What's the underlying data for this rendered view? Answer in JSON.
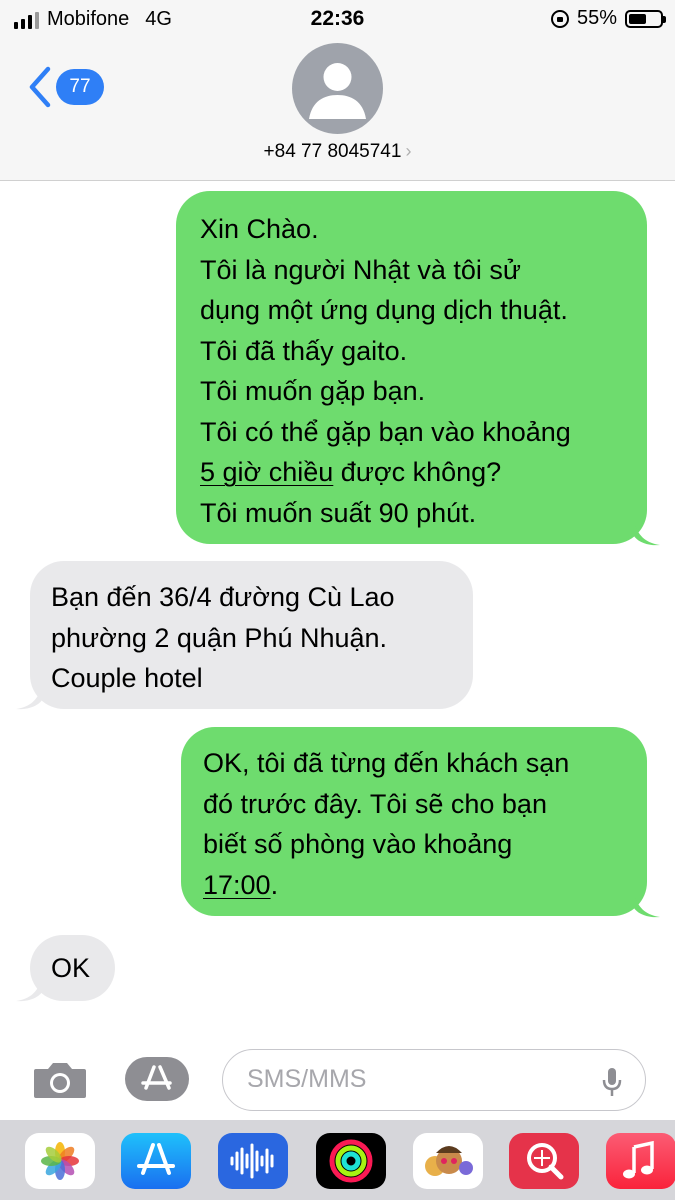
{
  "status_bar": {
    "carrier": "Mobifone",
    "network": "4G",
    "time": "22:36",
    "battery_percent": "55%",
    "battery_level": 0.55
  },
  "header": {
    "back_count": "77",
    "contact_number": "+84 77 8045741",
    "contact_arrow": "›"
  },
  "messages": [
    {
      "direction": "sent",
      "lines": [
        "Xin Chào.",
        "Tôi là người Nhật và tôi sử",
        "dụng một ứng dụng dịch thuật.",
        "Tôi đã thấy gaito.",
        "Tôi muốn gặp bạn.",
        "Tôi có thể gặp bạn vào khoảng",
        "5 giờ chiều",
        " được không?",
        "Tôi muốn suất 90 phút."
      ]
    },
    {
      "direction": "received",
      "lines": [
        "Bạn đến 36/4 đường Cù Lao",
        "phường 2 quận Phú Nhuận.",
        "Couple hotel"
      ]
    },
    {
      "direction": "sent",
      "lines": [
        "OK, tôi đã từng đến khách sạn",
        "đó trước đây.  Tôi sẽ cho bạn",
        "biết số phòng vào khoảng",
        "17:00",
        "."
      ]
    },
    {
      "direction": "received",
      "lines": [
        "OK"
      ]
    }
  ],
  "input": {
    "placeholder": "SMS/MMS"
  },
  "colors": {
    "sent_bubble": "#6edc6e",
    "received_bubble": "#e9e9eb",
    "accent": "#2f7ff6"
  },
  "icons": [
    "camera-icon",
    "app-store-icon",
    "microphone-icon",
    "photos-app-icon",
    "app-store-app-icon",
    "audio-app-icon",
    "activity-app-icon",
    "memoji-app-icon",
    "search-app-icon",
    "music-app-icon"
  ]
}
